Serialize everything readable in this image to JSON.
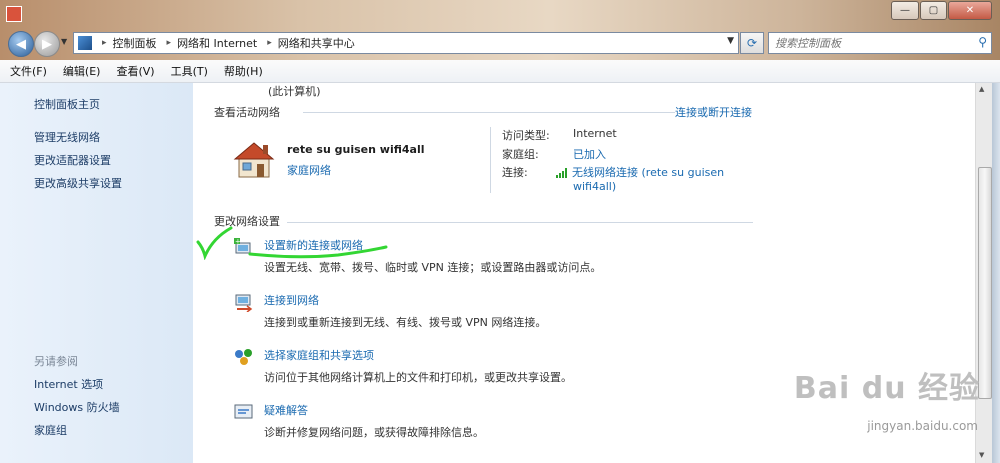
{
  "window": {
    "caption_buttons": {
      "minimize": "—",
      "maximize": "▢",
      "close": "✕"
    }
  },
  "nav": {
    "back_icon": "back-arrow-icon",
    "forward_icon": "forward-arrow-icon",
    "breadcrumb": [
      "控制面板",
      "网络和 Internet",
      "网络和共享中心"
    ],
    "search_placeholder": "搜索控制面板"
  },
  "menubar": {
    "items": [
      "文件(F)",
      "编辑(E)",
      "查看(V)",
      "工具(T)",
      "帮助(H)"
    ]
  },
  "sidebar": {
    "home": "控制面板主页",
    "links": [
      "管理无线网络",
      "更改适配器设置",
      "更改高级共享设置"
    ],
    "see_also_heading": "另请参阅",
    "see_also": [
      "Internet 选项",
      "Windows 防火墙",
      "家庭组"
    ]
  },
  "main": {
    "top_fragment": "(此计算机)",
    "active_networks": {
      "heading": "查看活动网络",
      "connect_link": "连接或断开连接",
      "network_name": "rete su guisen wifi4all",
      "network_type": "家庭网络",
      "access_type_label": "访问类型:",
      "access_type_value": "Internet",
      "homegroup_label": "家庭组:",
      "homegroup_value": "已加入",
      "connection_label": "连接:",
      "connection_value_line1": "无线网络连接 (rete su guisen",
      "connection_value_line2": "wifi4all)"
    },
    "change_settings": {
      "heading": "更改网络设置",
      "tasks": [
        {
          "title": "设置新的连接或网络",
          "desc": "设置无线、宽带、拨号、临时或 VPN 连接；或设置路由器或访问点。"
        },
        {
          "title": "连接到网络",
          "desc": "连接到或重新连接到无线、有线、拨号或 VPN 网络连接。"
        },
        {
          "title": "选择家庭组和共享选项",
          "desc": "访问位于其他网络计算机上的文件和打印机，或更改共享设置。"
        },
        {
          "title": "疑难解答",
          "desc": "诊断并修复网络问题，或获得故障排除信息。"
        }
      ]
    }
  },
  "watermark": {
    "brand": "Bai du 经验",
    "url": "jingyan.baidu.com"
  },
  "colors": {
    "link": "#1a6ab0",
    "sidebar": "#dbe8f6",
    "annotation": "#33d633"
  }
}
